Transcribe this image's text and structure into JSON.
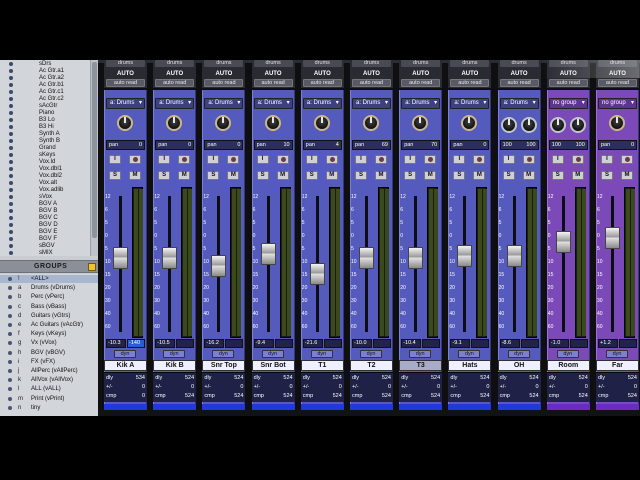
{
  "track_list": [
    {
      "name": "sDrs",
      "shown": true
    },
    {
      "name": "Ac Gtr.a1",
      "shown": true
    },
    {
      "name": "Ac Gtr.a2",
      "shown": true
    },
    {
      "name": "Ac Gtr.b1",
      "shown": true
    },
    {
      "name": "Ac Gtr.c1",
      "shown": true
    },
    {
      "name": "Ac Gtr.c2",
      "shown": true
    },
    {
      "name": "sAcGtr",
      "shown": true
    },
    {
      "name": "Piano",
      "shown": true
    },
    {
      "name": "B3 Lo",
      "shown": true
    },
    {
      "name": "B3 Hi",
      "shown": true
    },
    {
      "name": "Synth A",
      "shown": true
    },
    {
      "name": "Synth B",
      "shown": true
    },
    {
      "name": "Grand",
      "shown": true
    },
    {
      "name": "sKeys",
      "shown": true
    },
    {
      "name": "Vox.ld",
      "shown": true
    },
    {
      "name": "Vox.dbl1",
      "shown": true
    },
    {
      "name": "Vox.dbl2",
      "shown": true
    },
    {
      "name": "Vox.alt",
      "shown": true
    },
    {
      "name": "Vox.adlib",
      "shown": true
    },
    {
      "name": "sVox",
      "shown": true
    },
    {
      "name": "BGV A",
      "shown": true
    },
    {
      "name": "BGV B",
      "shown": true
    },
    {
      "name": "BGV C",
      "shown": true
    },
    {
      "name": "BGV D",
      "shown": true
    },
    {
      "name": "BGV E",
      "shown": true
    },
    {
      "name": "BGV F",
      "shown": true
    },
    {
      "name": "sBGV",
      "shown": true
    },
    {
      "name": "sMIX",
      "shown": true
    }
  ],
  "groups_panel": {
    "title": "GROUPS",
    "groups": [
      {
        "id": "!",
        "name": "<ALL>"
      },
      {
        "id": "a",
        "name": "Drums (vDrums)"
      },
      {
        "id": "b",
        "name": "Perc (vPerc)"
      },
      {
        "id": "c",
        "name": "Bass (vBass)"
      },
      {
        "id": "d",
        "name": "Guitars (vGtrs)"
      },
      {
        "id": "e",
        "name": "Ac Guitars (vAcGtr)"
      },
      {
        "id": "f",
        "name": "Keys (vKeys)"
      },
      {
        "id": "g",
        "name": "Vx (vVox)"
      },
      {
        "id": "h",
        "name": "BGV (vBGV)"
      },
      {
        "id": "i",
        "name": "FX (vFX)"
      },
      {
        "id": "j",
        "name": "AllPerc (vAllPerc)"
      },
      {
        "id": "k",
        "name": "AllVox (vAllVox)"
      },
      {
        "id": "l",
        "name": "ALL (vALL)"
      },
      {
        "id": "m",
        "name": "Print (vPrint)"
      },
      {
        "id": "n",
        "name": "tiny"
      }
    ]
  },
  "strips": [
    {
      "io": "drums",
      "auto": "AUTO",
      "autoread": "auto read",
      "group": "a: Drums",
      "pan": "pan",
      "pan_val": "0",
      "knobs": 1,
      "vol": "-10.3",
      "peak": "-140",
      "peak_hot": true,
      "name": "Kik A",
      "dly": "534",
      "pm": "0",
      "cmp": "0",
      "fader": 0.52,
      "color": "blue"
    },
    {
      "io": "drums",
      "auto": "AUTO",
      "autoread": "auto read",
      "group": "a: Drums",
      "pan": "pan",
      "pan_val": "0",
      "knobs": 1,
      "vol": "-10.5",
      "peak": "",
      "peak_hot": false,
      "name": "Kik B",
      "dly": "524",
      "pm": "0",
      "cmp": "524",
      "fader": 0.52,
      "color": "blue"
    },
    {
      "io": "drums",
      "auto": "AUTO",
      "autoread": "auto read",
      "group": "a: Drums",
      "pan": "pan",
      "pan_val": "0",
      "knobs": 1,
      "vol": "-16.2",
      "peak": "",
      "peak_hot": false,
      "name": "Snr Top",
      "dly": "524",
      "pm": "0",
      "cmp": "524",
      "fader": 0.58,
      "color": "blue"
    },
    {
      "io": "drums",
      "auto": "AUTO",
      "autoread": "auto read",
      "group": "a: Drums",
      "pan": "pan",
      "pan_val": "10",
      "knobs": 1,
      "vol": "-9.4",
      "peak": "",
      "peak_hot": false,
      "name": "Snr Bot",
      "dly": "524",
      "pm": "0",
      "cmp": "524",
      "fader": 0.48,
      "color": "blue"
    },
    {
      "io": "drums",
      "auto": "AUTO",
      "autoread": "auto read",
      "group": "a: Drums",
      "pan": "pan",
      "pan_val": "4",
      "knobs": 1,
      "vol": "-21.6",
      "peak": "",
      "peak_hot": false,
      "name": "T1",
      "dly": "524",
      "pm": "0",
      "cmp": "524",
      "fader": 0.65,
      "color": "blue"
    },
    {
      "io": "drums",
      "auto": "AUTO",
      "autoread": "auto read",
      "group": "a: Drums",
      "pan": "pan",
      "pan_val": "69",
      "knobs": 1,
      "vol": "-10.0",
      "peak": "",
      "peak_hot": false,
      "name": "T2",
      "dly": "524",
      "pm": "0",
      "cmp": "524",
      "fader": 0.52,
      "color": "blue"
    },
    {
      "io": "drums",
      "auto": "AUTO",
      "autoread": "auto read",
      "group": "a: Drums",
      "pan": "pan",
      "pan_val": "70",
      "knobs": 1,
      "vol": "-10.4",
      "peak": "",
      "peak_hot": false,
      "name": "T3",
      "dly": "524",
      "pm": "0",
      "cmp": "524",
      "fader": 0.52,
      "color": "blue",
      "highlight": true
    },
    {
      "io": "drums",
      "auto": "AUTO",
      "autoread": "auto read",
      "group": "a: Drums",
      "pan": "pan",
      "pan_val": "0",
      "knobs": 1,
      "vol": "-9.1",
      "peak": "",
      "peak_hot": false,
      "name": "Hats",
      "dly": "524",
      "pm": "0",
      "cmp": "524",
      "fader": 0.5,
      "color": "blue"
    },
    {
      "io": "drums",
      "auto": "AUTO",
      "autoread": "auto read",
      "group": "a: Drums",
      "pan": "100",
      "pan_val": "100",
      "knobs": 2,
      "vol": "-8.6",
      "peak": "",
      "peak_hot": false,
      "name": "OH",
      "dly": "524",
      "pm": "0",
      "cmp": "524",
      "fader": 0.5,
      "color": "blue"
    },
    {
      "io": "drums",
      "auto": "AUTO",
      "autoread": "auto read",
      "group": "no group",
      "pan": "100",
      "pan_val": "100",
      "knobs": 2,
      "vol": "-1.0",
      "peak": "",
      "peak_hot": false,
      "name": "Room",
      "dly": "524",
      "pm": "0",
      "cmp": "524",
      "fader": 0.38,
      "color": "purple"
    },
    {
      "io": "drums",
      "auto": "AUTO",
      "autoread": "auto read",
      "group": "no group",
      "pan": "pan",
      "pan_val": "0",
      "knobs": 1,
      "vol": "+1.2",
      "peak": "",
      "peak_hot": false,
      "name": "Far",
      "dly": "524",
      "pm": "0",
      "cmp": "524",
      "fader": 0.35,
      "color": "purple"
    }
  ],
  "fader_scale": [
    "12",
    "6",
    "5",
    "0",
    "5",
    "10",
    "15",
    "20",
    "30",
    "40",
    "60"
  ],
  "stat_labels": {
    "dly": "dly",
    "pm": "+/-",
    "cmp": "cmp"
  },
  "dyn_label": "dyn",
  "colors": {
    "strip_blue": "#545bbd",
    "strip_purple": "#7b4ab8",
    "accent_bottom": "#2338d8"
  }
}
